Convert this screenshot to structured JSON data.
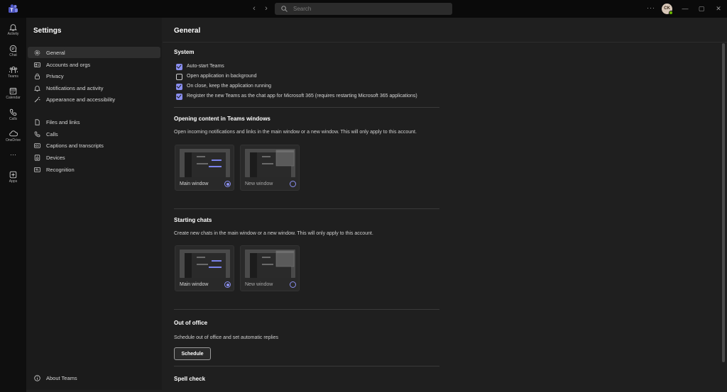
{
  "titlebar": {
    "search_placeholder": "Search",
    "avatar_initials": "CK",
    "more_glyph": "···",
    "back_glyph": "‹",
    "forward_glyph": "›",
    "min_glyph": "—",
    "max_glyph": "▢",
    "close_glyph": "✕"
  },
  "rail": {
    "items": [
      {
        "label": "Activity",
        "icon": "bell-icon"
      },
      {
        "label": "Chat",
        "icon": "chat-icon"
      },
      {
        "label": "Teams",
        "icon": "teams-icon"
      },
      {
        "label": "Calendar",
        "icon": "calendar-icon"
      },
      {
        "label": "Calls",
        "icon": "phone-icon"
      },
      {
        "label": "OneDrive",
        "icon": "cloud-icon"
      },
      {
        "label": "Apps",
        "icon": "apps-icon"
      }
    ],
    "more_glyph": "···"
  },
  "settings_nav": {
    "title": "Settings",
    "items": [
      {
        "label": "General",
        "icon": "gear-icon",
        "active": true
      },
      {
        "label": "Accounts and orgs",
        "icon": "accounts-icon"
      },
      {
        "label": "Privacy",
        "icon": "lock-icon"
      },
      {
        "label": "Notifications and activity",
        "icon": "bell-icon"
      },
      {
        "label": "Appearance and accessibility",
        "icon": "wand-icon"
      },
      {
        "label": "Files and links",
        "icon": "document-icon"
      },
      {
        "label": "Calls",
        "icon": "phone-icon"
      },
      {
        "label": "Captions and transcripts",
        "icon": "cc-icon"
      },
      {
        "label": "Devices",
        "icon": "device-icon"
      },
      {
        "label": "Recognition",
        "icon": "recognition-icon"
      }
    ],
    "about": "About Teams"
  },
  "main": {
    "title": "General",
    "system": {
      "title": "System",
      "options": [
        {
          "label": "Auto-start Teams",
          "checked": true
        },
        {
          "label": "Open application in background",
          "checked": false
        },
        {
          "label": "On close, keep the application running",
          "checked": true
        },
        {
          "label": "Register the new Teams as the chat app for Microsoft 365 (requires restarting Microsoft 365 applications)",
          "checked": true
        }
      ]
    },
    "opening": {
      "title": "Opening content in Teams windows",
      "desc": "Open incoming notifications and links in the main window or a new window. This will only apply to this account.",
      "options": [
        {
          "label": "Main window",
          "selected": true
        },
        {
          "label": "New window",
          "selected": false
        }
      ]
    },
    "chats": {
      "title": "Starting chats",
      "desc": "Create new chats in the main window or a new window. This will only apply to this account.",
      "options": [
        {
          "label": "Main window",
          "selected": true
        },
        {
          "label": "New window",
          "selected": false
        }
      ]
    },
    "ooo": {
      "title": "Out of office",
      "desc": "Schedule out of office and set automatic replies",
      "button": "Schedule"
    },
    "spell": {
      "title": "Spell check"
    }
  },
  "colors": {
    "accent": "#8a8ff0",
    "presence": "#6bb700"
  }
}
